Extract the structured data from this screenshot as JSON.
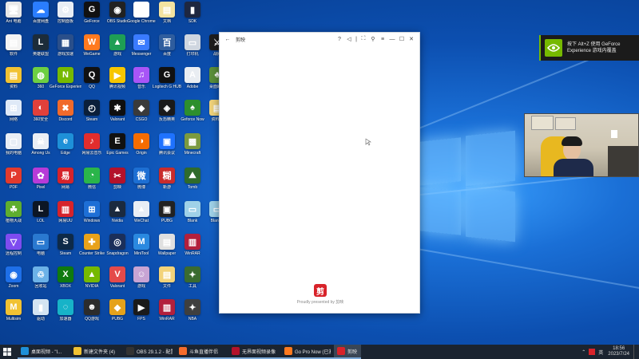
{
  "desktop": {
    "icons": [
      {
        "label": "Ant 电脑",
        "color": "#e8e8e8",
        "glyph": "🖥"
      },
      {
        "label": "百度网盘",
        "color": "#2a7dff",
        "glyph": "☁"
      },
      {
        "label": "控制面板",
        "color": "#e9eef5",
        "glyph": "⚙"
      },
      {
        "label": "GeForce",
        "color": "#111",
        "glyph": "G"
      },
      {
        "label": "OBS Studio",
        "color": "#222",
        "glyph": "◉"
      },
      {
        "label": "Google Chrome",
        "color": "#ffffff",
        "glyph": "◎"
      },
      {
        "label": "文档",
        "color": "#f4e3a0",
        "glyph": "▤"
      },
      {
        "label": "SDK",
        "color": "#1e2740",
        "glyph": "▮"
      },
      {
        "label": "软件",
        "color": "#f3f3f3",
        "glyph": "▤"
      },
      {
        "label": "英雄联盟",
        "color": "#1c2c3a",
        "glyph": "L"
      },
      {
        "label": "游戏加速",
        "color": "#2a4f8a",
        "glyph": "▦"
      },
      {
        "label": "WeGame",
        "color": "#ff7a1f",
        "glyph": "W"
      },
      {
        "label": "游戏",
        "color": "#1e9e55",
        "glyph": "▲"
      },
      {
        "label": "Messenger",
        "color": "#3a7bff",
        "glyph": "✉"
      },
      {
        "label": "百度",
        "color": "#2f5d9e",
        "glyph": "百"
      },
      {
        "label": "打印机",
        "color": "#cfd6e0",
        "glyph": "▭"
      },
      {
        "label": "战网",
        "color": "#1d1d1d",
        "glyph": "⚔"
      },
      {
        "label": "资料",
        "color": "#f1c232",
        "glyph": "▤"
      },
      {
        "label": "360",
        "color": "#6dcf42",
        "glyph": "◍"
      },
      {
        "label": "GeForce Experience",
        "color": "#76b900",
        "glyph": "N"
      },
      {
        "label": "QQ",
        "color": "#111",
        "glyph": "Q"
      },
      {
        "label": "腾讯视频",
        "color": "#f7c600",
        "glyph": "▶"
      },
      {
        "label": "音乐",
        "color": "#a855f7",
        "glyph": "♫"
      },
      {
        "label": "Logitech G HUB",
        "color": "#111",
        "glyph": "G"
      },
      {
        "label": "Adobe",
        "color": "#e9edf2",
        "glyph": "A"
      },
      {
        "label": "桌面助手",
        "color": "#5a8f3a",
        "glyph": "♣"
      },
      {
        "label": "网络",
        "color": "#dfe9f7",
        "glyph": "⊞"
      },
      {
        "label": "360安全",
        "color": "#e2403a",
        "glyph": "◐"
      },
      {
        "label": "Discord",
        "color": "#f06a2b",
        "glyph": "✖"
      },
      {
        "label": "Steam",
        "color": "#0b1f3a",
        "glyph": "◴"
      },
      {
        "label": "Valorant",
        "color": "#0f0f0f",
        "glyph": "✱"
      },
      {
        "label": "CSGO",
        "color": "#3a3a3a",
        "glyph": "◆"
      },
      {
        "label": "反恐精英",
        "color": "#1a1a1a",
        "glyph": "◈"
      },
      {
        "label": "Geforce Now",
        "color": "#2d8f2d",
        "glyph": "♠"
      },
      {
        "label": "资料夹",
        "color": "#efd27a",
        "glyph": "▤"
      },
      {
        "label": "我的电脑",
        "color": "#e9eef5",
        "glyph": "▢"
      },
      {
        "label": "Among Us",
        "color": "#e9eef5",
        "glyph": "☠"
      },
      {
        "label": "Edge",
        "color": "#1e90d8",
        "glyph": "e"
      },
      {
        "label": "网易云音乐",
        "color": "#e22d2d",
        "glyph": "♪"
      },
      {
        "label": "Epic Games",
        "color": "#111",
        "glyph": "E"
      },
      {
        "label": "Origin",
        "color": "#f56c00",
        "glyph": "◑"
      },
      {
        "label": "腾讯会议",
        "color": "#1e72ff",
        "glyph": "▣"
      },
      {
        "label": "Minecraft",
        "color": "#7b9a3f",
        "glyph": "▩"
      },
      {
        "label": "PDF",
        "color": "#e23a2d",
        "glyph": "P"
      },
      {
        "label": "Pixel",
        "color": "#b73bd8",
        "glyph": "✿"
      },
      {
        "label": "网易",
        "color": "#d6232b",
        "glyph": "易"
      },
      {
        "label": "微信",
        "color": "#2ab54a",
        "glyph": "◔"
      },
      {
        "label": "剪映",
        "color": "#b3122b",
        "glyph": "✂"
      },
      {
        "label": "微博",
        "color": "#1d6fd3",
        "glyph": "微"
      },
      {
        "label": "新游",
        "color": "#c92c2c",
        "glyph": "糊"
      },
      {
        "label": "Tomb",
        "color": "#2f6b2b",
        "glyph": "⛰"
      },
      {
        "label": "植物大战",
        "color": "#5fae2f",
        "glyph": "☘"
      },
      {
        "label": "LOL",
        "color": "#0c1624",
        "glyph": "L"
      },
      {
        "label": "网易UU",
        "color": "#d6232b",
        "glyph": "▥"
      },
      {
        "label": "Windows",
        "color": "#1e6fd6",
        "glyph": "⊞"
      },
      {
        "label": "Nvidia",
        "color": "#1b2a3e",
        "glyph": "▲"
      },
      {
        "label": "WeChat",
        "color": "#e9eef5",
        "glyph": "▲"
      },
      {
        "label": "PUBG",
        "color": "#222",
        "glyph": "▣"
      },
      {
        "label": "Blank",
        "color": "#9fd1e8",
        "glyph": "▭"
      },
      {
        "label": "Blank 2",
        "color": "#9fd1e8",
        "glyph": "▭"
      },
      {
        "label": "远程控制",
        "color": "#7e4cf0",
        "glyph": "▽"
      },
      {
        "label": "电脑",
        "color": "#2a79d0",
        "glyph": "▭"
      },
      {
        "label": "Steam",
        "color": "#0e2a48",
        "glyph": "S"
      },
      {
        "label": "Counter Strike",
        "color": "#e8a21a",
        "glyph": "✚"
      },
      {
        "label": "Snapdragon",
        "color": "#1b2f5a",
        "glyph": "◎"
      },
      {
        "label": "MiniTool",
        "color": "#2a89e0",
        "glyph": "M"
      },
      {
        "label": "Wallpaper",
        "color": "#e0e0e0",
        "glyph": "▤"
      },
      {
        "label": "WinRAR",
        "color": "#b2203c",
        "glyph": "▥"
      },
      {
        "label": "Zoom",
        "color": "#1e6fe8",
        "glyph": "◉"
      },
      {
        "label": "回收站",
        "color": "#6cb2e8",
        "glyph": "♲"
      },
      {
        "label": "XBOX",
        "color": "#0f7a0f",
        "glyph": "X"
      },
      {
        "label": "NVIDIA",
        "color": "#76b900",
        "glyph": "▲"
      },
      {
        "label": "Valorant",
        "color": "#e44a4a",
        "glyph": "V"
      },
      {
        "label": "游戏",
        "color": "#c8a4d4",
        "glyph": "☺"
      },
      {
        "label": "文件",
        "color": "#f3d37a",
        "glyph": "▤"
      },
      {
        "label": "工具",
        "color": "#3a6b2f",
        "glyph": "✦"
      },
      {
        "label": "Multisim",
        "color": "#f1c232",
        "glyph": "M"
      },
      {
        "label": "驱动",
        "color": "#d3e4f2",
        "glyph": "▮"
      },
      {
        "label": "加速器",
        "color": "#17b3c8",
        "glyph": "◌"
      },
      {
        "label": "QQ游戏",
        "color": "#2c2c2c",
        "glyph": "☻"
      },
      {
        "label": "PUBG",
        "color": "#e5a21a",
        "glyph": "◆"
      },
      {
        "label": "FPS",
        "color": "#1a1a1a",
        "glyph": "▶"
      },
      {
        "label": "WinRAR",
        "color": "#b2203c",
        "glyph": "▥"
      },
      {
        "label": "NBA",
        "color": "#3f3f3f",
        "glyph": "✦"
      }
    ]
  },
  "app_window": {
    "title": "剪映",
    "footer": "Proudly presented by 剪映",
    "logo_glyph": "剪",
    "controls": {
      "back": "←",
      "help": "?",
      "volume": "◁",
      "fullscreen": "⛶",
      "pin": "⚲",
      "menu": "≡",
      "minimize": "—",
      "maximize": "☐",
      "close": "✕"
    }
  },
  "notification": {
    "line1": "按下 Alt+Z 使用 GeForce",
    "line2": "Experience 游戏内覆盖"
  },
  "taskbar": {
    "items": [
      {
        "label": "桌面视频 - \"I...",
        "color": "#1e90d8",
        "active": false
      },
      {
        "label": "新建文件夹 (4)",
        "color": "#f1c232",
        "active": false
      },
      {
        "label": "OBS 29.1.2 - 配置...",
        "color": "#333",
        "active": false
      },
      {
        "label": "斗鱼直播伴侣",
        "color": "#f56c2b",
        "active": false
      },
      {
        "label": "无界面视频录像",
        "color": "#b3122b",
        "active": false
      },
      {
        "label": "Go Pro Now (已激...",
        "color": "#ff7a1f",
        "active": false
      },
      {
        "label": "剪映",
        "color": "#d8232a",
        "active": true
      }
    ],
    "tray": {
      "ime": "英",
      "time": "18:56",
      "date": "2023/7/24"
    }
  }
}
